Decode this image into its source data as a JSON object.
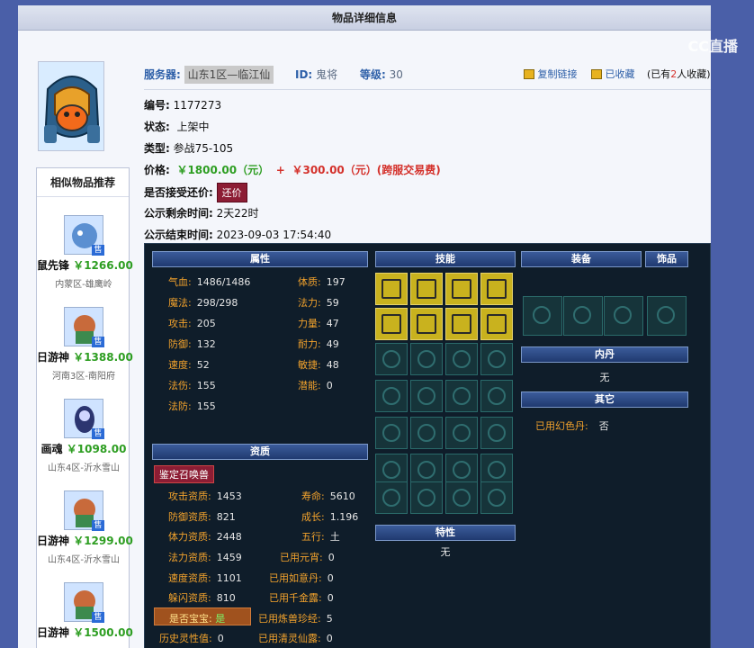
{
  "titlebar": {
    "title": "物品详细信息"
  },
  "watermark": {
    "text": "CC直播"
  },
  "header": {
    "server_label": "服务器:",
    "server_value": "山东1区—临江仙",
    "id_label": "ID:",
    "id_value": "鬼将",
    "level_label": "等级:",
    "level_value": "30",
    "copy_link": "复制链接",
    "favorited": "已收藏",
    "fav_count_prefix": "(已有",
    "fav_count": "2",
    "fav_count_suffix": "人收藏)"
  },
  "item": {
    "id_label": "编号:",
    "id_value": "1177273",
    "status_label": "状态:",
    "status_value": "上架中",
    "type_label": "类型:",
    "type_value": "参战75-105",
    "price_label": "价格:",
    "price_main": "￥1800.00（元）",
    "price_plus": "+",
    "price_fee": "￥300.00（元）(跨服交易费)",
    "bargain_label": "是否接受还价:",
    "bargain_button": "还价",
    "remaining_label": "公示剩余时间:",
    "remaining_value": "2天22时",
    "end_label": "公示结束时间:",
    "end_value": "2023-09-03 17:54:40"
  },
  "sidebar": {
    "title": "相似物品推荐",
    "sell_badge": "售",
    "items": [
      {
        "name": "鼠先锋",
        "price": "￥1266.00",
        "server": "内蒙区-雄鹰岭"
      },
      {
        "name": "日游神",
        "price": "￥1388.00",
        "server": "河南3区-南阳府"
      },
      {
        "name": "画魂",
        "price": "￥1098.00",
        "server": "山东4区-沂水雪山"
      },
      {
        "name": "日游神",
        "price": "￥1299.00",
        "server": "山东4区-沂水雪山"
      },
      {
        "name": "日游神",
        "price": "￥1500.00",
        "server": ""
      }
    ]
  },
  "game": {
    "attr_header": "属性",
    "skill_header": "技能",
    "equip_header": "装备",
    "ornament_header": "饰品",
    "neidan_header": "内丹",
    "neidan_value": "无",
    "other_header": "其它",
    "other_label": "已用幻色丹:",
    "other_value": "否",
    "trait_header": "特性",
    "trait_value": "无",
    "aptitude_header": "资质",
    "appraise_button": "鉴定召唤兽",
    "attrs_left": [
      {
        "k": "气血:",
        "v": "1486/1486"
      },
      {
        "k": "魔法:",
        "v": "298/298"
      },
      {
        "k": "攻击:",
        "v": "205"
      },
      {
        "k": "防御:",
        "v": "132"
      },
      {
        "k": "速度:",
        "v": "52"
      },
      {
        "k": "法伤:",
        "v": "155"
      },
      {
        "k": "法防:",
        "v": "155"
      }
    ],
    "attrs_right": [
      {
        "k": "体质:",
        "v": "197"
      },
      {
        "k": "法力:",
        "v": "59"
      },
      {
        "k": "力量:",
        "v": "47"
      },
      {
        "k": "耐力:",
        "v": "49"
      },
      {
        "k": "敏捷:",
        "v": "48"
      },
      {
        "k": "潜能:",
        "v": "0"
      }
    ],
    "apt_left": [
      {
        "k": "攻击资质:",
        "v": "1453"
      },
      {
        "k": "防御资质:",
        "v": "821"
      },
      {
        "k": "体力资质:",
        "v": "2448"
      },
      {
        "k": "法力资质:",
        "v": "1459"
      },
      {
        "k": "速度资质:",
        "v": "1101"
      },
      {
        "k": "躲闪资质:",
        "v": "810"
      },
      {
        "k": "是否宝宝:",
        "v": "是"
      },
      {
        "k": "历史灵性值:",
        "v": "0"
      }
    ],
    "apt_right": [
      {
        "k": "寿命:",
        "v": "5610"
      },
      {
        "k": "成长:",
        "v": "1.196"
      },
      {
        "k": "五行:",
        "v": "土"
      },
      {
        "k": "已用元宵:",
        "v": "0"
      },
      {
        "k": "已用如意丹:",
        "v": "0"
      },
      {
        "k": "已用千金露:",
        "v": "0"
      },
      {
        "k": "已用炼兽珍经:",
        "v": "5"
      },
      {
        "k": "已用清灵仙露:",
        "v": "0"
      }
    ]
  }
}
